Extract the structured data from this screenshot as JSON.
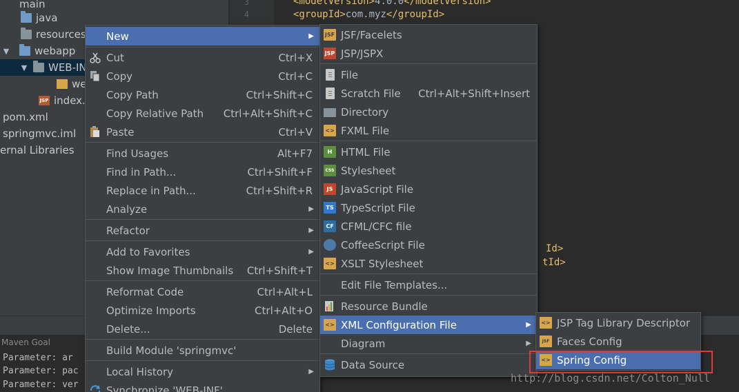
{
  "project_tree": {
    "items": [
      {
        "label": "main",
        "indent": 0
      },
      {
        "label": "java"
      },
      {
        "label": "resources"
      },
      {
        "label": "webapp",
        "arrow": "▼"
      },
      {
        "label": "WEB-IN",
        "arrow": "▼"
      },
      {
        "label": "we"
      },
      {
        "label": "index."
      },
      {
        "label": "pom.xml"
      },
      {
        "label": "springmvc.iml"
      },
      {
        "label": "ernal Libraries"
      }
    ]
  },
  "editor": {
    "line_numbers": [
      "3",
      "4"
    ],
    "lines": [
      {
        "open": "<modelVersion>",
        "text": "4.0.0",
        "close": "</modelVersion>"
      },
      {
        "open": "<groupId>",
        "text": "com.myz",
        "close": "</groupId>"
      }
    ],
    "partial_tags": [
      "Id>",
      "tId>"
    ]
  },
  "bottom_panel": {
    "title": "Maven Goal",
    "console_lines": [
      "Parameter: ar",
      "Parameter: pac",
      "Parameter: ver"
    ]
  },
  "context_menu": {
    "items": [
      {
        "label": "New",
        "has_submenu": true,
        "highlighted": true
      },
      {
        "label": "Cut",
        "shortcut": "Ctrl+X",
        "icon": "scissors-icon"
      },
      {
        "label": "Copy",
        "shortcut": "Ctrl+C",
        "icon": "copy-icon"
      },
      {
        "label": "Copy Path",
        "shortcut": "Ctrl+Shift+C"
      },
      {
        "label": "Copy Relative Path",
        "shortcut": "Ctrl+Alt+Shift+C"
      },
      {
        "label": "Paste",
        "shortcut": "Ctrl+V",
        "icon": "paste-icon"
      },
      {
        "label": "Find Usages",
        "shortcut": "Alt+F7"
      },
      {
        "label": "Find in Path...",
        "shortcut": "Ctrl+Shift+F"
      },
      {
        "label": "Replace in Path...",
        "shortcut": "Ctrl+Shift+R"
      },
      {
        "label": "Analyze",
        "has_submenu": true
      },
      {
        "label": "Refactor",
        "has_submenu": true
      },
      {
        "label": "Add to Favorites",
        "has_submenu": true
      },
      {
        "label": "Show Image Thumbnails",
        "shortcut": "Ctrl+Shift+T"
      },
      {
        "label": "Reformat Code",
        "shortcut": "Ctrl+Alt+L"
      },
      {
        "label": "Optimize Imports",
        "shortcut": "Ctrl+Alt+O"
      },
      {
        "label": "Delete...",
        "shortcut": "Delete"
      },
      {
        "label": "Build Module 'springmvc'"
      },
      {
        "label": "Local History",
        "has_submenu": true
      },
      {
        "label": "Synchronize 'WEB-INF'",
        "icon": "sync-icon"
      }
    ]
  },
  "new_submenu": {
    "items": [
      {
        "label": "JSF/Facelets",
        "icon": "jsf-icon"
      },
      {
        "label": "JSP/JSPX",
        "icon": "jsp-icon"
      },
      {
        "label": "File",
        "icon": "file-icon"
      },
      {
        "label": "Scratch File",
        "shortcut": "Ctrl+Alt+Shift+Insert",
        "icon": "scratch-file-icon"
      },
      {
        "label": "Directory",
        "icon": "folder-icon"
      },
      {
        "label": "FXML File",
        "icon": "fxml-icon"
      },
      {
        "label": "HTML File",
        "icon": "html-icon"
      },
      {
        "label": "Stylesheet",
        "icon": "css-icon"
      },
      {
        "label": "JavaScript File",
        "icon": "js-icon"
      },
      {
        "label": "TypeScript File",
        "icon": "ts-icon"
      },
      {
        "label": "CFML/CFC file",
        "icon": "cf-icon"
      },
      {
        "label": "CoffeeScript File",
        "icon": "coffee-icon"
      },
      {
        "label": "XSLT Stylesheet",
        "icon": "xslt-icon"
      },
      {
        "label": "Edit File Templates..."
      },
      {
        "label": "Resource Bundle",
        "icon": "resource-bundle-icon"
      },
      {
        "label": "XML Configuration File",
        "has_submenu": true,
        "highlighted": true,
        "icon": "xml-icon"
      },
      {
        "label": "Diagram",
        "has_submenu": true
      },
      {
        "label": "Data Source",
        "icon": "database-icon"
      }
    ]
  },
  "xml_submenu": {
    "items": [
      {
        "label": "JSP Tag Library Descriptor",
        "icon": "tld-icon"
      },
      {
        "label": "Faces Config",
        "icon": "faces-icon"
      },
      {
        "label": "Spring Config",
        "highlighted": true,
        "icon": "spring-icon"
      }
    ]
  },
  "icon_text": {
    "html": "H",
    "css": "CSS",
    "js": "JS",
    "ts": "TS",
    "cf": "CF",
    "jsp": "JSP",
    "jsf": "JSF",
    "xml": "<>"
  },
  "watermark": "http://blog.csdn.net/Colton_Null",
  "colors": {
    "menu_bg": "#3c3f41",
    "highlight": "#4b6eaf",
    "annotation_box": "#e03a3a"
  }
}
